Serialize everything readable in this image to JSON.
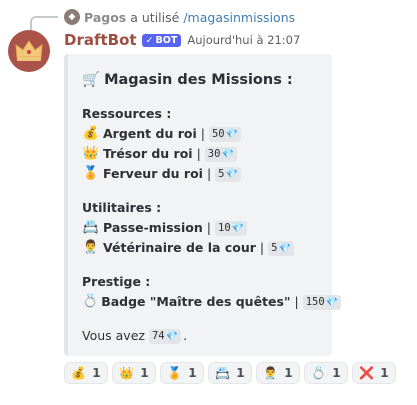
{
  "reply": {
    "user": "Pagos",
    "text": "a utilisé",
    "command": "/magasinmissions"
  },
  "message": {
    "author": "DraftBot",
    "bot_badge": "BOT",
    "timestamp": "Aujourd'hui à 21:07"
  },
  "embed": {
    "title": "Magasin des Missions :",
    "title_emoji": "🛒",
    "sections": [
      {
        "heading": "Ressources :",
        "items": [
          {
            "emoji": "💰",
            "name": "Argent du roi",
            "sep": "|",
            "price": "50"
          },
          {
            "emoji": "👑",
            "name": "Trésor du roi",
            "sep": "|",
            "price": "30"
          },
          {
            "emoji": "🏅",
            "name": "Ferveur du roi",
            "sep": "|",
            "price": "5"
          }
        ]
      },
      {
        "heading": "Utilitaires :",
        "items": [
          {
            "emoji": "📇",
            "name": "Passe-mission",
            "sep": "|",
            "price": "10"
          },
          {
            "emoji": "👨‍⚕️",
            "name": "Vétérinaire de la cour",
            "sep": "|",
            "price": "5"
          }
        ]
      },
      {
        "heading": "Prestige :",
        "items": [
          {
            "emoji": "💍",
            "name": "Badge \"Maître des quêtes\"",
            "sep": "|",
            "price": "150"
          }
        ]
      }
    ],
    "balance_prefix": "Vous avez",
    "balance_value": "74",
    "balance_suffix": ".",
    "gem": "💎"
  },
  "reactions": [
    {
      "emoji": "💰",
      "count": "1"
    },
    {
      "emoji": "👑",
      "count": "1"
    },
    {
      "emoji": "🏅",
      "count": "1"
    },
    {
      "emoji": "📇",
      "count": "1"
    },
    {
      "emoji": "👨‍⚕️",
      "count": "1"
    },
    {
      "emoji": "💍",
      "count": "1"
    },
    {
      "emoji": "❌",
      "count": "1"
    }
  ],
  "colors": {
    "author": "#9e4f43",
    "bot_badge": "#5865f2",
    "command": "#3d7fb6",
    "avatar": "#a9534a"
  }
}
